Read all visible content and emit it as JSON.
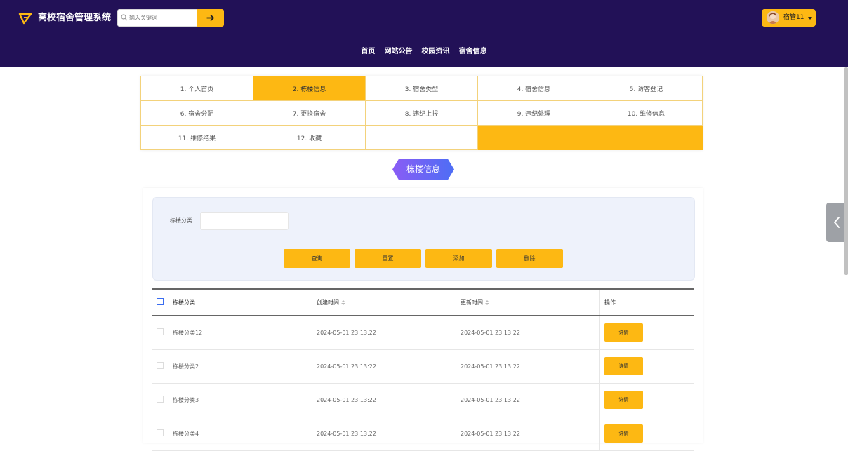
{
  "header": {
    "app_title": "高校宿舍管理系统",
    "search_placeholder": "输入关键词",
    "user_name": "宿管11"
  },
  "nav": [
    "首页",
    "网站公告",
    "校园资讯",
    "宿舍信息"
  ],
  "menu": [
    [
      "1. 个人首页",
      "2. 栋楼信息",
      "3. 宿舍类型",
      "4. 宿舍信息",
      "5. 访客登记"
    ],
    [
      "6. 宿舍分配",
      "7. 更换宿舍",
      "8. 违纪上报",
      "9. 违纪处理",
      "10. 维修信息"
    ],
    [
      "11. 维修结果",
      "12. 收藏"
    ]
  ],
  "active_menu": "2. 栋楼信息",
  "section_title": "栋楼信息",
  "filter": {
    "label": "栋楼分类",
    "buttons": [
      "查询",
      "重置",
      "添加",
      "删除"
    ]
  },
  "table": {
    "headers": [
      "栋楼分类",
      "创建时间",
      "更新时间",
      "操作"
    ],
    "rows": [
      {
        "category": "栋楼分类12",
        "created": "2024-05-01 23:13:22",
        "updated": "2024-05-01 23:13:22",
        "action": "详情"
      },
      {
        "category": "栋楼分类2",
        "created": "2024-05-01 23:13:22",
        "updated": "2024-05-01 23:13:22",
        "action": "详情"
      },
      {
        "category": "栋楼分类3",
        "created": "2024-05-01 23:13:22",
        "updated": "2024-05-01 23:13:22",
        "action": "详情"
      },
      {
        "category": "栋楼分类4",
        "created": "2024-05-01 23:13:22",
        "updated": "2024-05-01 23:13:22",
        "action": "详情"
      }
    ]
  },
  "colors": {
    "header_bg": "#221157",
    "accent": "#fdb813",
    "badge_gradient_start": "#8a5cf5",
    "badge_gradient_end": "#4d6ef5"
  }
}
